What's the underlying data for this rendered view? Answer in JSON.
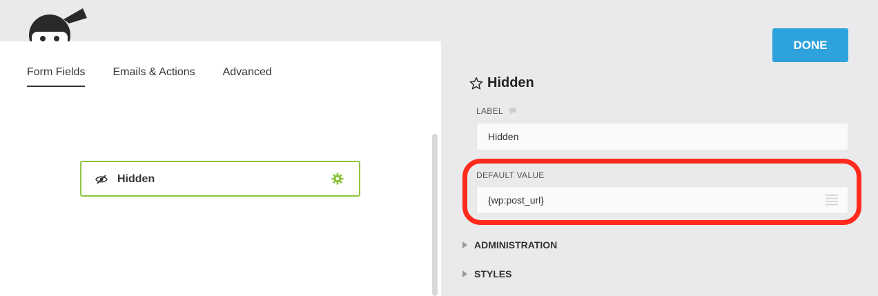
{
  "tabs": [
    {
      "label": "Form Fields",
      "active": true
    },
    {
      "label": "Emails & Actions",
      "active": false
    },
    {
      "label": "Advanced",
      "active": false
    }
  ],
  "field": {
    "title": "Hidden",
    "icon": "eye-slash-icon",
    "gear_icon": "gear-icon"
  },
  "done_button": "DONE",
  "drawer": {
    "title": "Hidden",
    "label_setting": {
      "label": "LABEL",
      "value": "Hidden"
    },
    "default_value": {
      "label": "DEFAULT VALUE",
      "value": "{wp:post_url}"
    },
    "sections": [
      "ADMINISTRATION",
      "STYLES"
    ]
  },
  "colors": {
    "accent_green": "#8dc63f",
    "done_blue": "#2ea2dc",
    "highlight_red": "#ff2a1d"
  }
}
